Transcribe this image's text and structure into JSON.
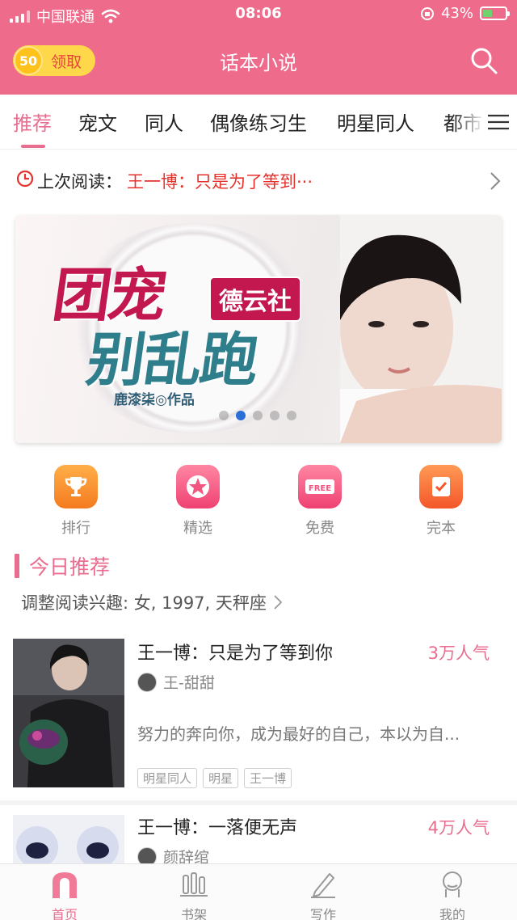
{
  "status_bar": {
    "carrier": "中国联通",
    "time": "08:06",
    "battery_percent": "43%",
    "battery_level": 0.43
  },
  "header": {
    "coin_amount": "50",
    "coin_label": "领取",
    "title": "话本小说",
    "search_icon": "search-icon"
  },
  "tabs": [
    {
      "label": "推荐",
      "active": true
    },
    {
      "label": "宠文"
    },
    {
      "label": "同人"
    },
    {
      "label": "偶像练习生"
    },
    {
      "label": "明星同人"
    },
    {
      "label": "都市"
    }
  ],
  "last_read": {
    "label": "上次阅读：",
    "title": "王一博：只是为了等到···"
  },
  "banner": {
    "title_line1": "团宠",
    "title_line2": "别乱跑",
    "tag": "德云社",
    "author": "鹿漆柒◎作品",
    "slide_count": 5,
    "active_slide": 2
  },
  "quick_entries": [
    {
      "label": "排行",
      "icon": "trophy-icon",
      "color": "#f7922e"
    },
    {
      "label": "精选",
      "icon": "star-icon",
      "color": "#f2557f"
    },
    {
      "label": "免费",
      "icon": "free-tag-icon",
      "color": "#f2557f"
    },
    {
      "label": "完本",
      "icon": "checked-book-icon",
      "color": "#f7652f"
    }
  ],
  "today": {
    "section_title": "今日推荐",
    "interest_text": "调整阅读兴趣: 女, 1997, 天秤座"
  },
  "books": [
    {
      "title": "王一博：只是为了等到你",
      "popularity": "3万人气",
      "author": "王-甜甜",
      "description": "努力的奔向你，成为最好的自己，本以为自...",
      "tags": [
        "明星同人",
        "明星",
        "王一博"
      ]
    },
    {
      "title": "王一博：一落便无声",
      "popularity": "4万人气",
      "author": "颜辞绾"
    }
  ],
  "bottom_nav": [
    {
      "label": "首页",
      "icon": "home-icon",
      "active": true
    },
    {
      "label": "书架",
      "icon": "bookshelf-icon"
    },
    {
      "label": "写作",
      "icon": "pen-icon"
    },
    {
      "label": "我的",
      "icon": "profile-icon"
    }
  ],
  "colors": {
    "brand_pink": "#ef6b8b",
    "accent_pink": "#e86d8f",
    "highlight_red": "#e5322d"
  }
}
